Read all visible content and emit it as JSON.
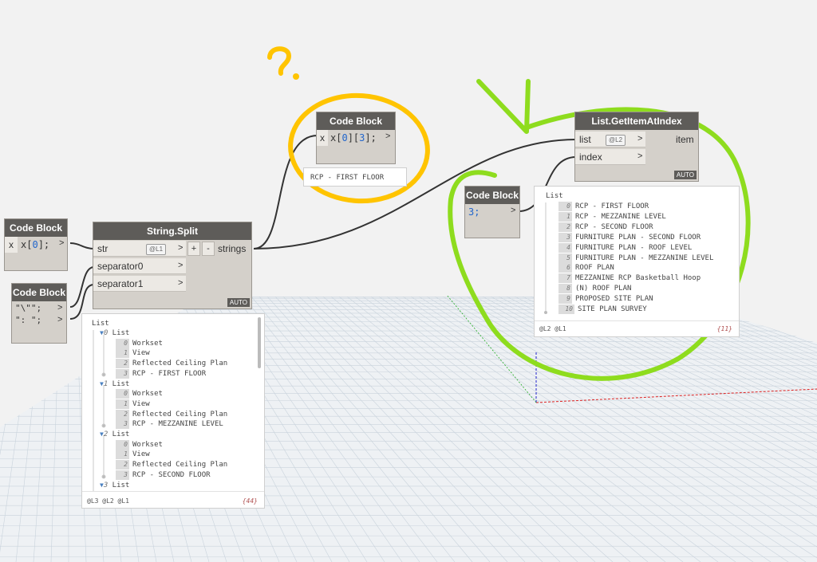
{
  "nodes": {
    "cb_index": {
      "title": "Code Block",
      "port": "x",
      "code_a": "x[",
      "code_n1": "0",
      "code_b": "];"
    },
    "cb_separators": {
      "title": "Code Block",
      "line1": "\"\\\"\";",
      "line2": "\": \";"
    },
    "string_split": {
      "title": "String.Split",
      "inputs": [
        "str",
        "separator0",
        "separator1"
      ],
      "output": "strings",
      "lacing": "@L1",
      "plus": "+",
      "minus": "-",
      "auto": "AUTO"
    },
    "cb_getitem": {
      "title": "Code Block",
      "port": "x",
      "code_a": "x[",
      "code_n1": "0",
      "code_m": "][",
      "code_n2": "3",
      "code_b": "];",
      "preview": "RCP - FIRST FLOOR"
    },
    "cb_three": {
      "title": "Code Block",
      "code": "3;"
    },
    "get_item": {
      "title": "List.GetItemAtIndex",
      "inputs": [
        "list",
        "index"
      ],
      "output": "item",
      "lacing": "@L2",
      "auto": "AUTO"
    }
  },
  "split_preview": {
    "header": "List",
    "groups": [
      {
        "index": "0",
        "label": "List",
        "items": [
          {
            "i": "0",
            "v": "Workset"
          },
          {
            "i": "1",
            "v": "View"
          },
          {
            "i": "2",
            "v": "Reflected Ceiling Plan"
          },
          {
            "i": "3",
            "v": "RCP - FIRST FLOOR"
          }
        ]
      },
      {
        "index": "1",
        "label": "List",
        "items": [
          {
            "i": "0",
            "v": "Workset"
          },
          {
            "i": "1",
            "v": "View"
          },
          {
            "i": "2",
            "v": "Reflected Ceiling Plan"
          },
          {
            "i": "3",
            "v": "RCP - MEZZANINE LEVEL"
          }
        ]
      },
      {
        "index": "2",
        "label": "List",
        "items": [
          {
            "i": "0",
            "v": "Workset"
          },
          {
            "i": "1",
            "v": "View"
          },
          {
            "i": "2",
            "v": "Reflected Ceiling Plan"
          },
          {
            "i": "3",
            "v": "RCP - SECOND FLOOR"
          }
        ]
      },
      {
        "index": "3",
        "label": "List",
        "items": []
      }
    ],
    "levels": "@L3 @L2 @L1",
    "count": "{44}"
  },
  "getitem_preview": {
    "header": "List",
    "items": [
      {
        "i": "0",
        "v": "RCP - FIRST FLOOR"
      },
      {
        "i": "1",
        "v": "RCP - MEZZANINE LEVEL"
      },
      {
        "i": "2",
        "v": "RCP - SECOND FLOOR"
      },
      {
        "i": "3",
        "v": "FURNITURE PLAN - SECOND FLOOR"
      },
      {
        "i": "4",
        "v": "FURNITURE PLAN - ROOF LEVEL"
      },
      {
        "i": "5",
        "v": "FURNITURE PLAN - MEZZANINE LEVEL"
      },
      {
        "i": "6",
        "v": "ROOF PLAN"
      },
      {
        "i": "7",
        "v": "MEZZANINE RCP Basketball Hoop"
      },
      {
        "i": "8",
        "v": "(N) ROOF PLAN"
      },
      {
        "i": "9",
        "v": "PROPOSED SITE PLAN"
      },
      {
        "i": "10",
        "v": "SITE PLAN SURVEY"
      }
    ],
    "levels": "@L2 @L1",
    "count": "{11}"
  },
  "annotations": {
    "question": "?",
    "yellow": "#ffc400",
    "green": "#8edc1e"
  }
}
